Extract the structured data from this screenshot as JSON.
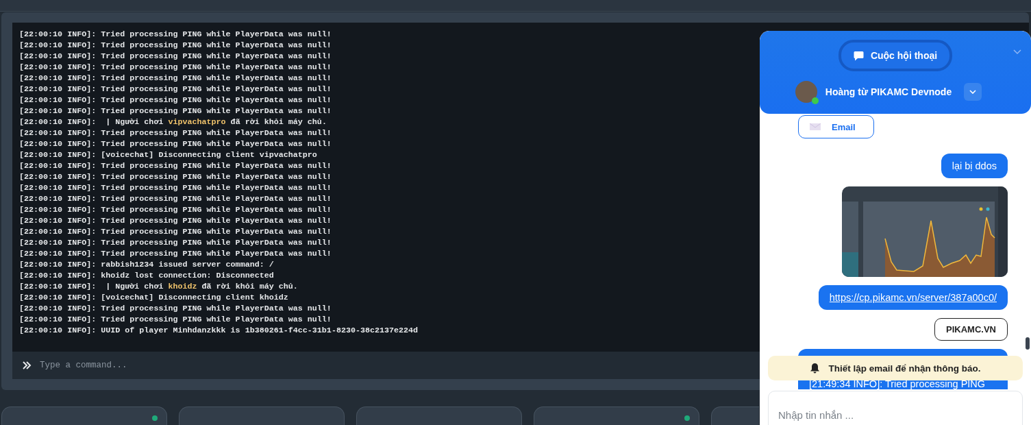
{
  "console": {
    "lines": [
      {
        "parts": [
          {
            "text": "[22:00:10 INFO]: Tried processing PING while PlayerData was null!",
            "highlight": false
          }
        ]
      },
      {
        "parts": [
          {
            "text": "[22:00:10 INFO]: Tried processing PING while PlayerData was null!",
            "highlight": false
          }
        ]
      },
      {
        "parts": [
          {
            "text": "[22:00:10 INFO]: Tried processing PING while PlayerData was null!",
            "highlight": false
          }
        ]
      },
      {
        "parts": [
          {
            "text": "[22:00:10 INFO]: Tried processing PING while PlayerData was null!",
            "highlight": false
          }
        ]
      },
      {
        "parts": [
          {
            "text": "[22:00:10 INFO]: Tried processing PING while PlayerData was null!",
            "highlight": false
          }
        ]
      },
      {
        "parts": [
          {
            "text": "[22:00:10 INFO]: Tried processing PING while PlayerData was null!",
            "highlight": false
          }
        ]
      },
      {
        "parts": [
          {
            "text": "[22:00:10 INFO]: Tried processing PING while PlayerData was null!",
            "highlight": false
          }
        ]
      },
      {
        "parts": [
          {
            "text": "[22:00:10 INFO]: Tried processing PING while PlayerData was null!",
            "highlight": false
          }
        ]
      },
      {
        "parts": [
          {
            "text": "[22:00:10 INFO]:  | Người chơi ",
            "highlight": false
          },
          {
            "text": "vipvachatpro",
            "highlight": true
          },
          {
            "text": " đã rời khỏi máy chủ.",
            "highlight": false
          }
        ]
      },
      {
        "parts": [
          {
            "text": "[22:00:10 INFO]: Tried processing PING while PlayerData was null!",
            "highlight": false
          }
        ]
      },
      {
        "parts": [
          {
            "text": "[22:00:10 INFO]: Tried processing PING while PlayerData was null!",
            "highlight": false
          }
        ]
      },
      {
        "parts": [
          {
            "text": "[22:00:10 INFO]: [voicechat] Disconnecting client vipvachatpro",
            "highlight": false
          }
        ]
      },
      {
        "parts": [
          {
            "text": "[22:00:10 INFO]: Tried processing PING while PlayerData was null!",
            "highlight": false
          }
        ]
      },
      {
        "parts": [
          {
            "text": "[22:00:10 INFO]: Tried processing PING while PlayerData was null!",
            "highlight": false
          }
        ]
      },
      {
        "parts": [
          {
            "text": "[22:00:10 INFO]: Tried processing PING while PlayerData was null!",
            "highlight": false
          }
        ]
      },
      {
        "parts": [
          {
            "text": "[22:00:10 INFO]: Tried processing PING while PlayerData was null!",
            "highlight": false
          }
        ]
      },
      {
        "parts": [
          {
            "text": "[22:00:10 INFO]: Tried processing PING while PlayerData was null!",
            "highlight": false
          }
        ]
      },
      {
        "parts": [
          {
            "text": "[22:00:10 INFO]: Tried processing PING while PlayerData was null!",
            "highlight": false
          }
        ]
      },
      {
        "parts": [
          {
            "text": "[22:00:10 INFO]: Tried processing PING while PlayerData was null!",
            "highlight": false
          }
        ]
      },
      {
        "parts": [
          {
            "text": "[22:00:10 INFO]: Tried processing PING while PlayerData was null!",
            "highlight": false
          }
        ]
      },
      {
        "parts": [
          {
            "text": "[22:00:10 INFO]: Tried processing PING while PlayerData was null!",
            "highlight": false
          }
        ]
      },
      {
        "parts": [
          {
            "text": "[22:00:10 INFO]: rabbish1234 issued server command: /",
            "highlight": false
          }
        ]
      },
      {
        "parts": [
          {
            "text": "[22:00:10 INFO]: khoidz lost connection: Disconnected",
            "highlight": false
          }
        ]
      },
      {
        "parts": [
          {
            "text": "[22:00:10 INFO]:  | Người chơi ",
            "highlight": false
          },
          {
            "text": "khoidz",
            "highlight": true
          },
          {
            "text": " đã rời khỏi máy chủ.",
            "highlight": false
          }
        ]
      },
      {
        "parts": [
          {
            "text": "[22:00:10 INFO]: [voicechat] Disconnecting client khoidz",
            "highlight": false
          }
        ]
      },
      {
        "parts": [
          {
            "text": "[22:00:10 INFO]: Tried processing PING while PlayerData was null!",
            "highlight": false
          }
        ]
      },
      {
        "parts": [
          {
            "text": "[22:00:10 INFO]: Tried processing PING while PlayerData was null!",
            "highlight": false
          }
        ]
      },
      {
        "parts": [
          {
            "text": "[22:00:10 INFO]: UUID of player Minhdanzkkk is 1b380261-f4cc-31b1-8230-38c2137e224d",
            "highlight": false
          }
        ]
      }
    ],
    "command_placeholder": "Type a command..."
  },
  "server_cards": [
    {
      "online": true
    },
    {
      "online": false
    },
    {
      "online": false
    },
    {
      "online": true
    },
    {
      "online": false
    }
  ],
  "chat": {
    "conversations_button": "Cuộc hội thoại",
    "agent": {
      "name": "Hoàng từ PIKAMC Devnode",
      "online": true
    },
    "messages": [
      {
        "kind": "option",
        "text": "Email"
      },
      {
        "kind": "bubble",
        "text": "lại bị ddos"
      },
      {
        "kind": "picture"
      },
      {
        "kind": "link",
        "text": "https://cp.pikamc.vn/server/387a00c0/"
      },
      {
        "kind": "tag",
        "text": "PIKAMC.VN"
      },
      {
        "kind": "log",
        "lines": [
          "[21:49:34 INFO]: Tried processing PING"
        ]
      }
    ],
    "notice": "Thiết lập email để nhận thông báo.",
    "input_placeholder": "Nhập tin nhắn ..."
  }
}
